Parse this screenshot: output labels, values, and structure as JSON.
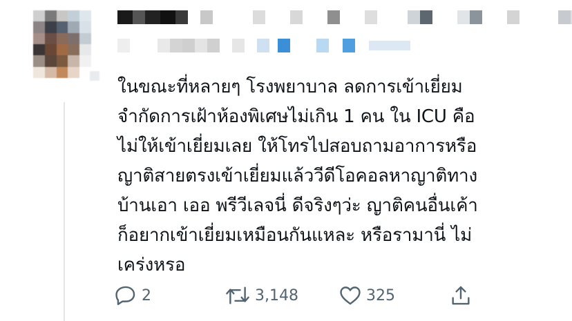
{
  "tweet": {
    "body_lines": [
      "ในขณะที่หลายๆ โรงพยาบาล ลดการเข้าเยี่ยม",
      "จำกัดการเฝ้าห้องพิเศษไม่เกิน 1 คน ใน ICU คือ",
      "ไม่ให้เข้าเยี่ยมเลย ให้โทรไปสอบถามอาการหรือ",
      "ญาติสายตรงเข้าเยี่ยมแล้ววีดีโอคอลหาญาติทาง",
      "บ้านเอา เออ พรีวีเลจนี่ ดีจริงๆว่ะ ญาติคนอื่นเค้า",
      "ก็อยากเข้าเยี่ยมเหมือนกันแหละ หรือรามานี่ ไม่",
      "เคร่งหรอ"
    ],
    "actions": {
      "reply_count": "2",
      "retweet_count": "3,148",
      "like_count": "325"
    },
    "icons": {
      "reply": "reply-icon",
      "retweet": "retweet-icon",
      "like": "heart-icon",
      "share": "share-icon"
    },
    "colors": {
      "text": "#0f1419",
      "secondary": "#536471",
      "thread_line": "#e3e6e9"
    }
  }
}
